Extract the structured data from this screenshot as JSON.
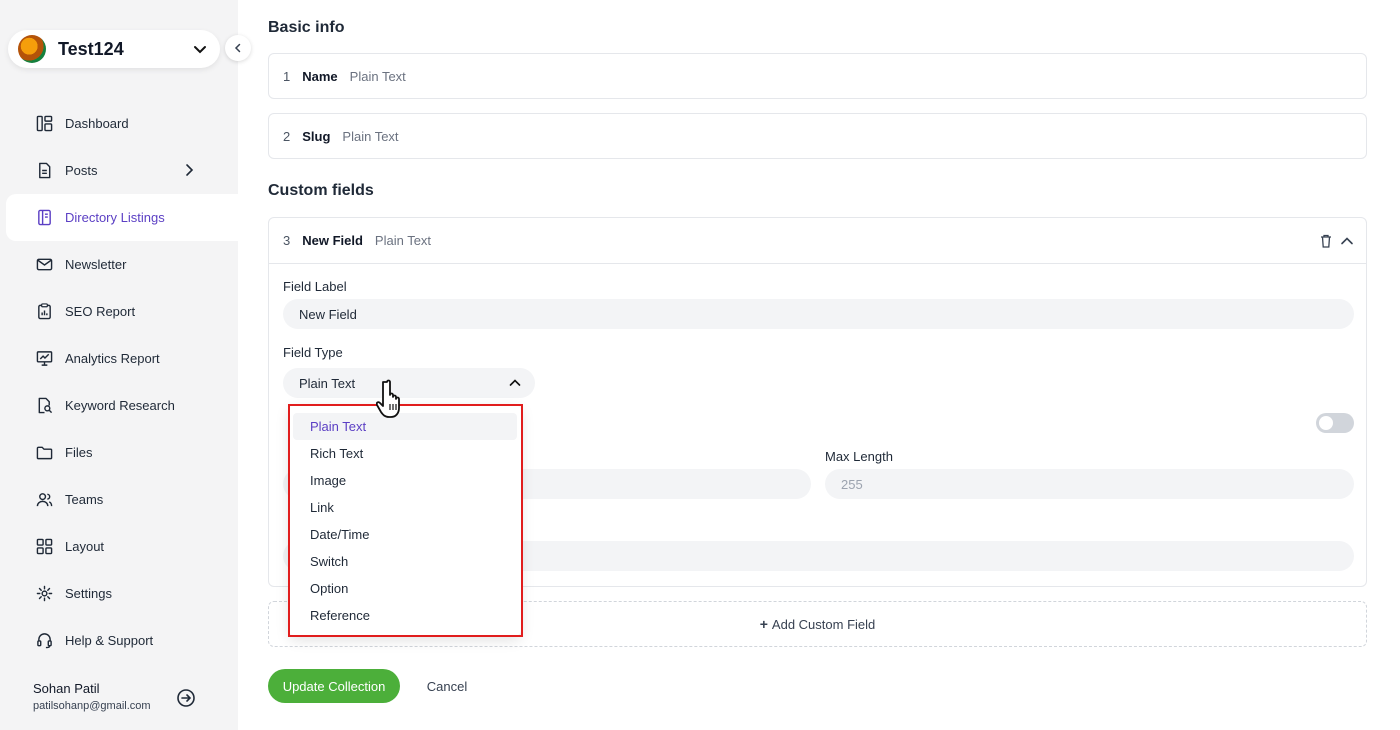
{
  "workspace": {
    "name": "Test124"
  },
  "sidebar": {
    "items": [
      {
        "label": "Dashboard",
        "icon": "dashboard-icon"
      },
      {
        "label": "Posts",
        "icon": "document-icon",
        "has_submenu": true
      },
      {
        "label": "Directory Listings",
        "icon": "book-icon",
        "active": true
      },
      {
        "label": "Newsletter",
        "icon": "mail-icon"
      },
      {
        "label": "SEO Report",
        "icon": "clipboard-chart-icon"
      },
      {
        "label": "Analytics Report",
        "icon": "monitor-chart-icon"
      },
      {
        "label": "Keyword Research",
        "icon": "file-search-icon"
      },
      {
        "label": "Files",
        "icon": "folder-icon"
      },
      {
        "label": "Teams",
        "icon": "users-icon"
      },
      {
        "label": "Layout",
        "icon": "grid-icon"
      },
      {
        "label": "Settings",
        "icon": "gear-icon"
      },
      {
        "label": "Help & Support",
        "icon": "headset-icon"
      }
    ],
    "user": {
      "name": "Sohan Patil",
      "email": "patilsohanp@gmail.com"
    }
  },
  "basic_info": {
    "title": "Basic info",
    "fields": [
      {
        "num": "1",
        "name": "Name",
        "type": "Plain Text"
      },
      {
        "num": "2",
        "name": "Slug",
        "type": "Plain Text"
      }
    ]
  },
  "custom_fields": {
    "title": "Custom fields",
    "field": {
      "num": "3",
      "name": "New Field",
      "type": "Plain Text",
      "label_caption": "Field Label",
      "label_value": "New Field",
      "type_caption": "Field Type",
      "type_value": "Plain Text",
      "max_length_caption": "Max Length",
      "max_length_placeholder": "255"
    },
    "add_label": "Add Custom Field"
  },
  "dropdown": {
    "options": [
      "Plain Text",
      "Rich Text",
      "Image",
      "Link",
      "Date/Time",
      "Switch",
      "Option",
      "Reference"
    ],
    "selected": "Plain Text"
  },
  "actions": {
    "update": "Update Collection",
    "cancel": "Cancel"
  },
  "colors": {
    "accent": "#5b3fc4",
    "primary_button": "#4caf3a",
    "highlight": "#e11d1d"
  }
}
